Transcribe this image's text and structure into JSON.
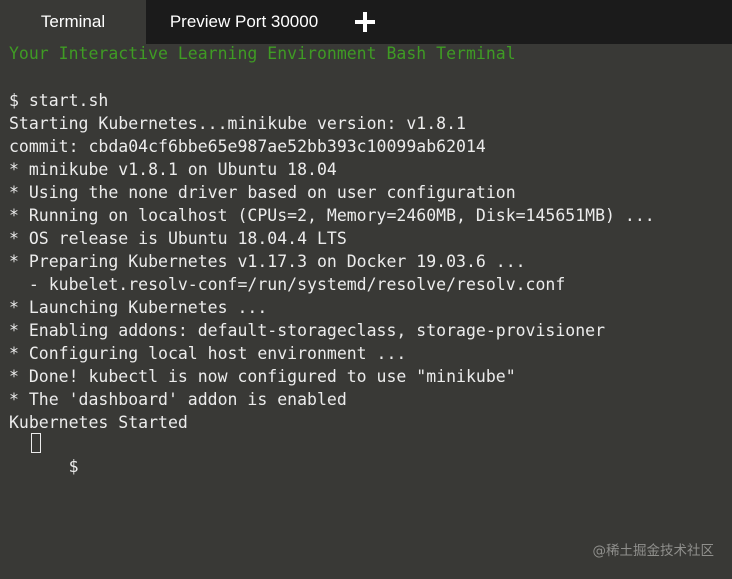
{
  "tabs": {
    "terminal_label": "Terminal",
    "preview_label": "Preview Port 30000",
    "add_icon": "plus-icon"
  },
  "terminal": {
    "banner": "Your Interactive Learning Environment Bash Terminal",
    "lines": [
      "$ start.sh",
      "Starting Kubernetes...minikube version: v1.8.1",
      "commit: cbda04cf6bbe65e987ae52bb393c10099ab62014",
      "* minikube v1.8.1 on Ubuntu 18.04",
      "* Using the none driver based on user configuration",
      "* Running on localhost (CPUs=2, Memory=2460MB, Disk=145651MB) ...",
      "* OS release is Ubuntu 18.04.4 LTS",
      "* Preparing Kubernetes v1.17.3 on Docker 19.03.6 ...",
      "  - kubelet.resolv-conf=/run/systemd/resolve/resolv.conf",
      "* Launching Kubernetes ...",
      "* Enabling addons: default-storageclass, storage-provisioner",
      "* Configuring local host environment ...",
      "* Done! kubectl is now configured to use \"minikube\"",
      "* The 'dashboard' addon is enabled",
      "Kubernetes Started"
    ],
    "prompt": "$"
  },
  "watermark": "@稀土掘金技术社区",
  "colors": {
    "tabbar_bg": "#1b1b1b",
    "terminal_bg": "#393936",
    "banner_green": "#3f9b24",
    "text": "#ececec"
  }
}
